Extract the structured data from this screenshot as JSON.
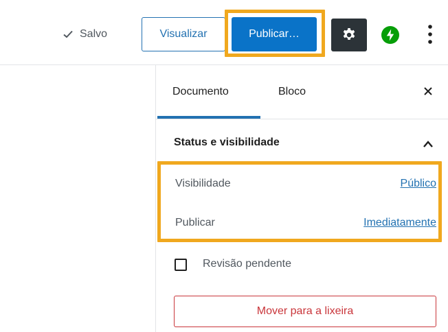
{
  "header": {
    "saved_label": "Salvo",
    "preview_label": "Visualizar",
    "publish_label": "Publicar…",
    "icons": {
      "saved": "check-icon",
      "settings": "gear-icon",
      "jetpack": "jetpack-bolt-icon",
      "more": "vertical-ellipsis-icon"
    },
    "colors": {
      "primary": "#0a73c8",
      "link": "#2271b1",
      "settings_bg": "#2c3338",
      "jetpack_green": "#069e08",
      "highlight": "#f0a81e"
    }
  },
  "sidebar": {
    "tabs": [
      {
        "label": "Documento",
        "active": true
      },
      {
        "label": "Bloco",
        "active": false
      }
    ],
    "close_icon": "close-icon",
    "panel": {
      "title": "Status e visibilidade",
      "toggle_icon": "chevron-up-icon",
      "rows": [
        {
          "label": "Visibilidade",
          "value": "Público"
        },
        {
          "label": "Publicar",
          "value": "Imediatamente"
        }
      ],
      "pending_review_label": "Revisão pendente",
      "pending_review_checked": false,
      "trash_label": "Mover para a lixeira",
      "danger_color": "#c9353a"
    }
  }
}
